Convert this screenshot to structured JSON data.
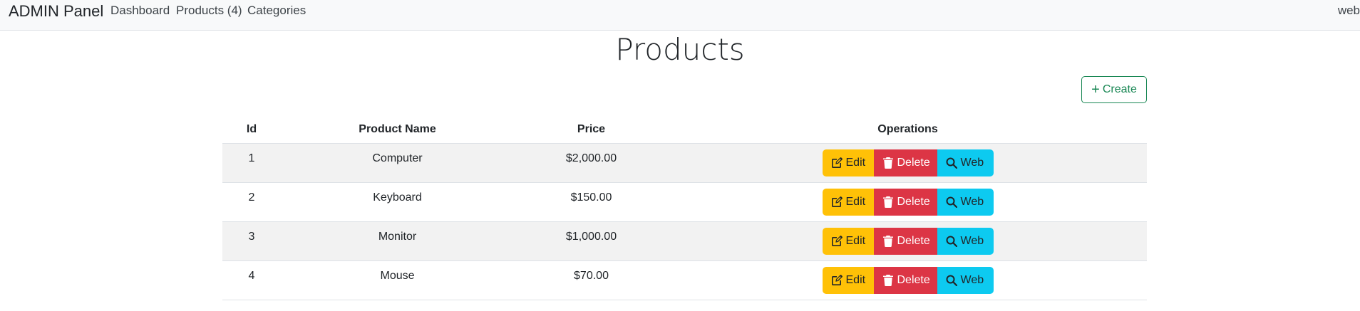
{
  "navbar": {
    "brand": "ADMIN Panel",
    "links": [
      {
        "label": "Dashboard"
      },
      {
        "label": "Products (4)"
      },
      {
        "label": "Categories"
      }
    ],
    "right_link": "web"
  },
  "page": {
    "title": "Products",
    "create_label": "Create"
  },
  "table": {
    "headers": {
      "id": "Id",
      "name": "Product Name",
      "price": "Price",
      "operations": "Operations"
    },
    "rows": [
      {
        "id": "1",
        "name": "Computer",
        "price": "$2,000.00"
      },
      {
        "id": "2",
        "name": "Keyboard",
        "price": "$150.00"
      },
      {
        "id": "3",
        "name": "Monitor",
        "price": "$1,000.00"
      },
      {
        "id": "4",
        "name": "Mouse",
        "price": "$70.00"
      }
    ],
    "actions": {
      "edit": "Edit",
      "delete": "Delete",
      "web": "Web"
    }
  },
  "colors": {
    "edit": "#ffc107",
    "delete": "#dc3545",
    "web": "#0dcaf0",
    "create": "#198754",
    "stripe": "#f2f2f2"
  },
  "icons": {
    "create": "plus-icon",
    "edit": "pencil-square-icon",
    "delete": "trash-icon",
    "web": "search-icon"
  }
}
